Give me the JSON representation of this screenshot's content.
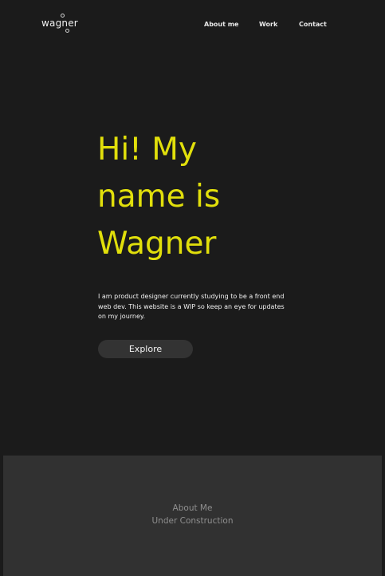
{
  "header": {
    "logo_text": "wagner",
    "nav": [
      {
        "label": "About me"
      },
      {
        "label": "Work"
      },
      {
        "label": "Contact"
      }
    ]
  },
  "hero": {
    "title_lines": [
      "Hi! My",
      "name is",
      "Wagner"
    ],
    "description": "I am product designer currently studying to be a front end web dev. This website is a WIP so keep an eye for updates on my journey.",
    "button_label": "Explore"
  },
  "about": {
    "title": "About Me",
    "status": "Under Construction"
  },
  "colors": {
    "background": "#1b1b1b",
    "accent": "#e1df0b",
    "section_background": "#313131",
    "button_background": "#333333"
  }
}
